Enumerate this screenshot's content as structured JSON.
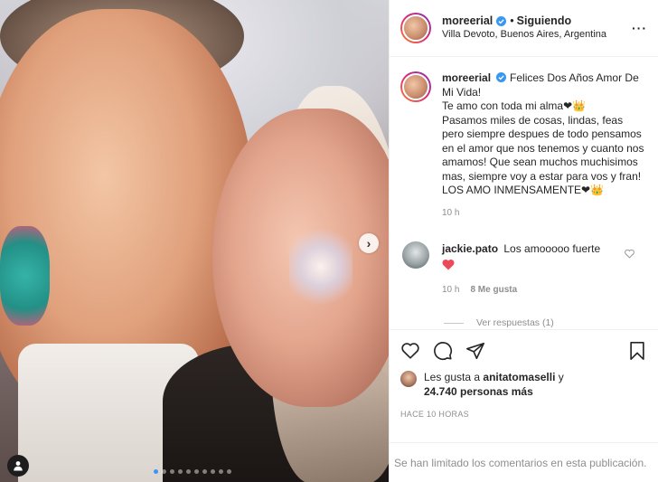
{
  "post": {
    "author": {
      "username": "moreerial",
      "follow_status": "Siguiendo",
      "separator": "•",
      "location": "Villa Devoto, Buenos Aires, Argentina"
    },
    "more_label": "···",
    "caption": {
      "text": "Felices Dos Años Amor De Mi Vida!\nTe amo con toda mi alma❤👑\nPasamos miles de cosas, lindas, feas pero siempre despues de todo pensamos en el amor que nos tenemos y cuanto nos amamos! Que sean muchos muchisimos mas, siempre voy a estar para vos y fran!\nLOS AMO INMENSAMENTE❤👑",
      "time": "10 h"
    },
    "comments": [
      {
        "username": "jackie.pato",
        "text": "Los amooooo fuerte",
        "time": "10 h",
        "likes": "8 Me gusta",
        "replies": "Ver respuestas (1)"
      }
    ],
    "likes": {
      "prefix": "Les gusta a",
      "user": "anitatomaselli",
      "conjunction": "y",
      "count": "24.740 personas más"
    },
    "date": "HACE 10 HORAS",
    "comments_limited": "Se han limitado los comentarios en esta publicación."
  },
  "media": {
    "next_label": "›",
    "carousel_total": 10,
    "carousel_index": 1
  },
  "colors": {
    "verified": "#3897f0",
    "heart": "#ed4956",
    "link_muted": "#8e8e8e",
    "carousel_active": "#3b95f6"
  },
  "icons": [
    "verified-icon",
    "more-icon",
    "heart-icon",
    "comment-icon",
    "share-icon",
    "save-icon",
    "next-arrow-icon",
    "user-tag-icon"
  ]
}
